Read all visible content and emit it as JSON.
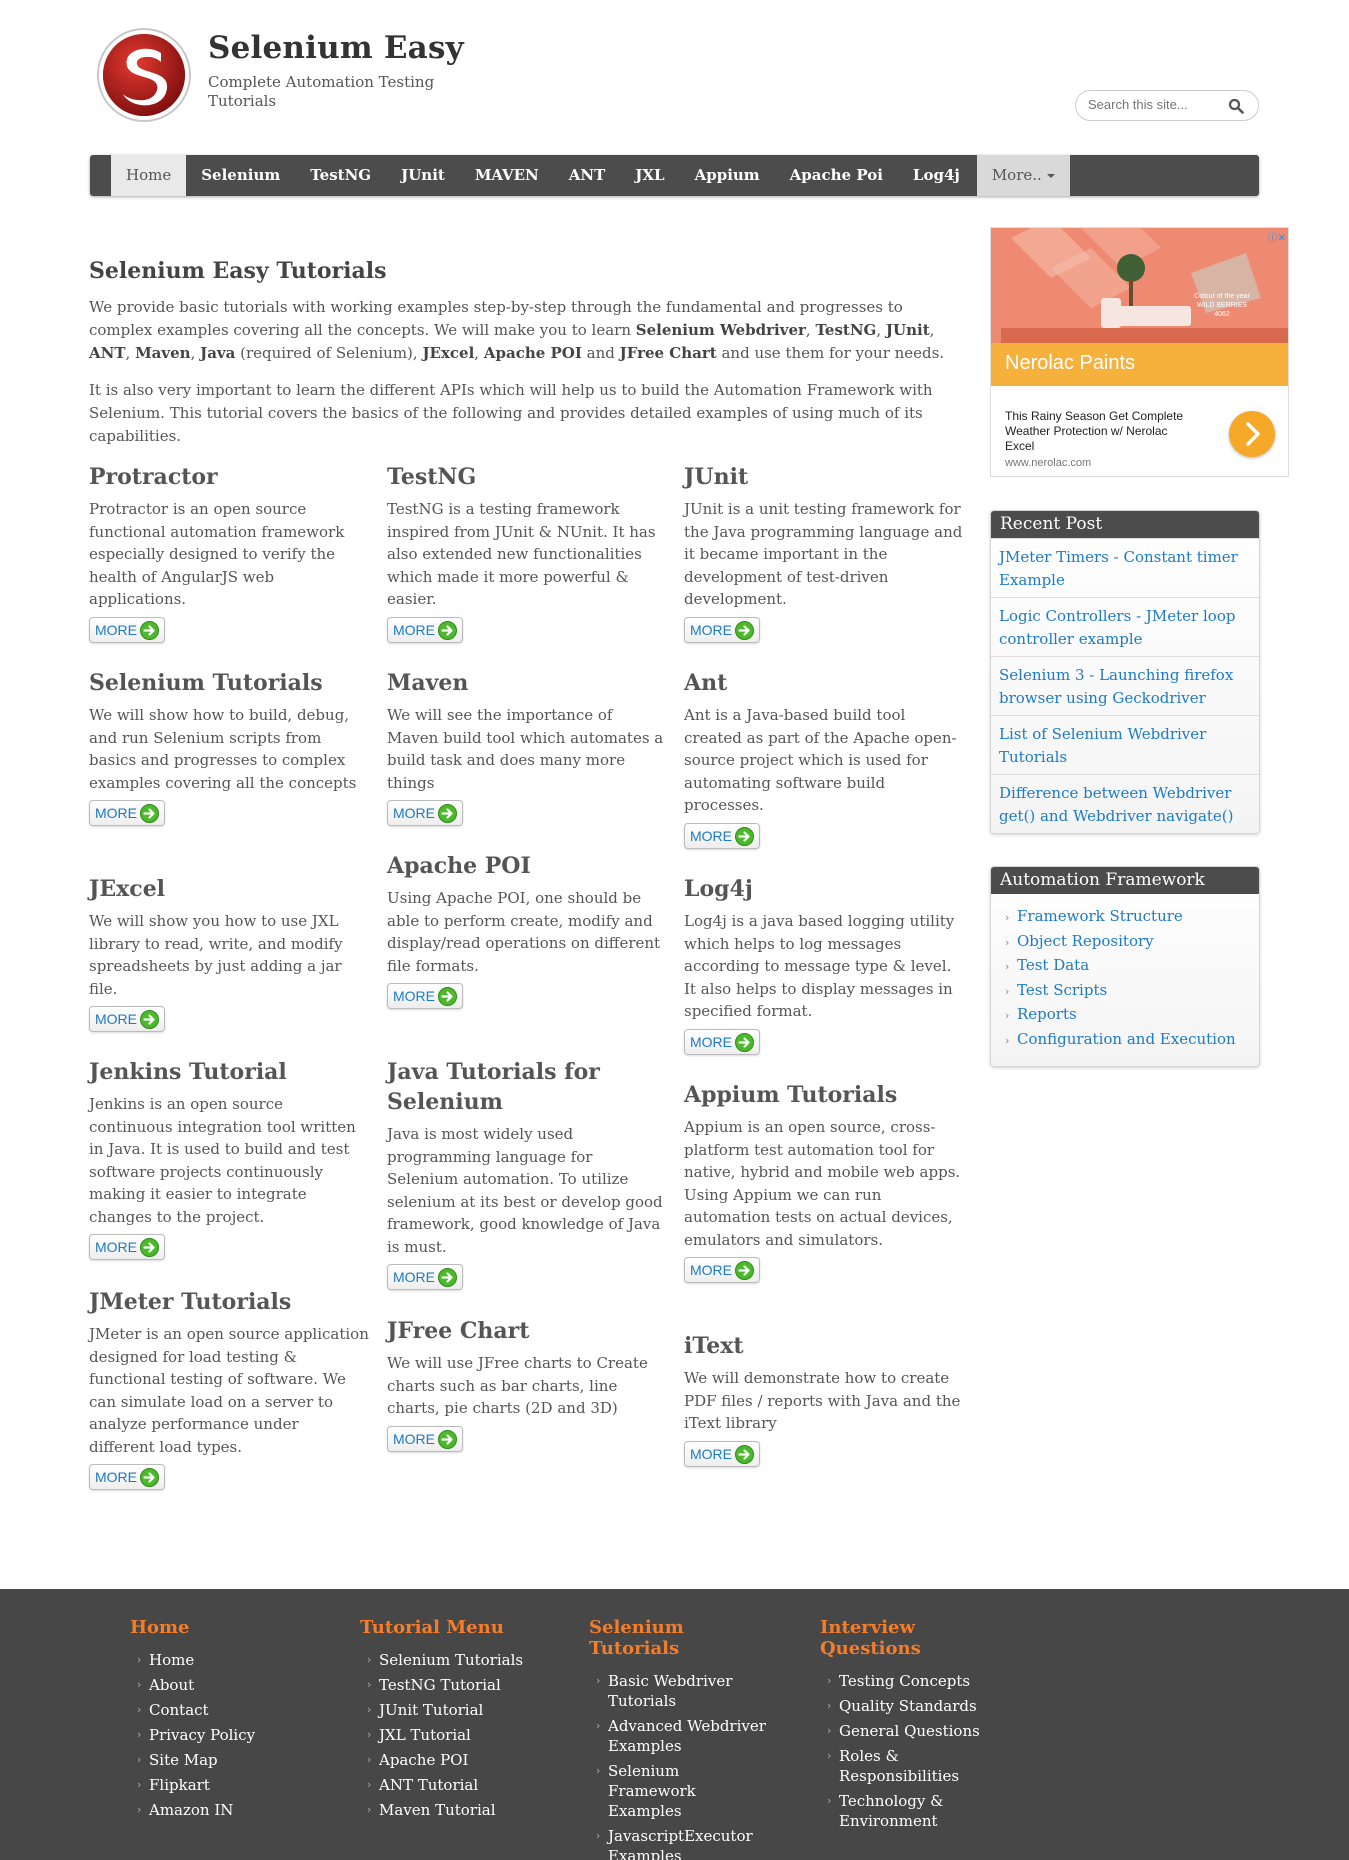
{
  "header": {
    "title": "Selenium Easy",
    "tagline": "Complete Automation Testing Tutorials",
    "search_placeholder": "Search this site..."
  },
  "nav": {
    "items": [
      "Home",
      "Selenium",
      "TestNG",
      "JUnit",
      "MAVEN",
      "ANT",
      "JXL",
      "Appium",
      "Apache Poi",
      "Log4j"
    ],
    "more_label": "More.."
  },
  "main": {
    "title": "Selenium Easy Tutorials",
    "intro1_a": "We provide basic tutorials with working examples step-by-step through the fundamental and progresses to complex examples covering all the concepts. We will make you to learn ",
    "b_webdriver": "Selenium Webdriver",
    "b_testng": "TestNG",
    "b_junit": "JUnit",
    "b_ant": "ANT",
    "b_maven": "Maven",
    "b_java": "Java",
    "intro1_req": " (required of Selenium), ",
    "b_jexcel": "JExcel",
    "b_apachepoi": "Apache POI",
    "and": " and ",
    "b_jfree": "JFree Chart",
    "intro1_end": " and use them for your needs.",
    "intro2": "It is also very important to learn the different APIs which will help us to build the Automation Framework with Selenium. This tutorial covers the basics of the following and provides detailed examples of using much of its capabilities."
  },
  "more_label": "MORE",
  "cards": [
    {
      "title": "Protractor",
      "text": "Protractor is an open source functional automation framework especially designed to verify the health of AngularJS web applications."
    },
    {
      "title": "TestNG",
      "text": "TestNG is a testing framework inspired from JUnit & NUnit. It has also extended new functionalities which made it more powerful & easier."
    },
    {
      "title": "JUnit",
      "text": "JUnit is a unit testing framework for the Java programming language and it became important in the development of test-driven development."
    },
    {
      "title": "Selenium Tutorials",
      "text": "We will show how to build, debug, and run Selenium scripts from basics and progresses to complex examples covering all the concepts"
    },
    {
      "title": "Maven",
      "text": "We will see the importance of Maven build tool which automates a build task and does many more things"
    },
    {
      "title": "Ant",
      "text": "Ant is a Java-based build tool created as part of the Apache open-source project which is used for automating software build processes."
    },
    {
      "title": "JExcel",
      "text": "We will show you how to use JXL library to read, write, and modify spreadsheets by just adding a jar file."
    },
    {
      "title": "Apache POI",
      "text": "Using Apache POI, one should be able to perform create, modify and display/read operations on different file formats."
    },
    {
      "title": "Log4j",
      "text": "Log4j is a java based logging utility which helps to log messages according to message type & level. It also helps to display messages in specified format."
    },
    {
      "title": "Jenkins Tutorial",
      "text": "Jenkins is an open source continuous integration tool written in Java. It is used to build and test software projects continuously making it easier to integrate changes to the project."
    },
    {
      "title": "Java Tutorials for Selenium",
      "text": "Java is most widely used programming language for Selenium automation. To utilize selenium at its best or develop good framework, good knowledge of Java is must."
    },
    {
      "title": "Appium Tutorials",
      "text": "Appium is an open source, cross-platform test automation tool for native, hybrid and mobile web apps. Using Appium we can run automation tests on actual devices, emulators and simulators."
    },
    {
      "title": "JMeter Tutorials",
      "text": "JMeter is an open source application designed for load testing & functional testing of software. We can simulate load on a server to analyze performance under different load types."
    },
    {
      "title": "JFree Chart",
      "text": "We will use JFree charts to Create charts such as bar charts, line charts, pie charts (2D and 3D)"
    },
    {
      "title": "iText",
      "text": "We will demonstrate how to create PDF files / reports with Java and the iText library"
    }
  ],
  "ad": {
    "brand": "Nerolac Paints",
    "text": "This Rainy Season Get Complete Weather Protection w/ Nerolac Excel",
    "url": "www.nerolac.com",
    "badge_line1": "Colour of the year",
    "badge_line2": "WILD BERRIES",
    "badge_line3": "4062"
  },
  "sidebar": {
    "recent_title": "Recent Post",
    "recent": [
      "JMeter Timers - Constant timer Example",
      "Logic Controllers - JMeter loop controller example",
      "Selenium 3 - Launching firefox browser using Geckodriver",
      "List of Selenium Webdriver Tutorials",
      "Difference between Webdriver get() and Webdriver navigate()"
    ],
    "framework_title": "Automation Framework",
    "framework": [
      "Framework Structure",
      "Object Repository",
      "Test Data",
      "Test Scripts",
      "Reports",
      "Configuration and Execution"
    ]
  },
  "footer": {
    "columns": [
      {
        "title": "Home",
        "items": [
          "Home",
          "About",
          "Contact",
          "Privacy Policy",
          "Site Map",
          "Flipkart",
          "Amazon IN"
        ]
      },
      {
        "title": "Tutorial Menu",
        "items": [
          "Selenium Tutorials",
          "TestNG Tutorial",
          "JUnit Tutorial",
          "JXL Tutorial",
          "Apache POI",
          "ANT Tutorial",
          "Maven Tutorial"
        ]
      },
      {
        "title": "Selenium Tutorials",
        "items": [
          "Basic Webdriver Tutorials",
          "Advanced Webdriver Examples",
          "Selenium Framework Examples",
          "JavascriptExecutor Examples"
        ]
      },
      {
        "title": "Interview Questions",
        "items": [
          "Testing Concepts",
          "Quality Standards",
          "General Questions",
          "Roles & Responsibilities",
          "Technology & Environment"
        ]
      }
    ]
  },
  "colors": {
    "nav_bg": "#4c4c4c",
    "link": "#1c7ac8",
    "footer_bg": "#474747",
    "footer_heading": "#f57d2a"
  }
}
